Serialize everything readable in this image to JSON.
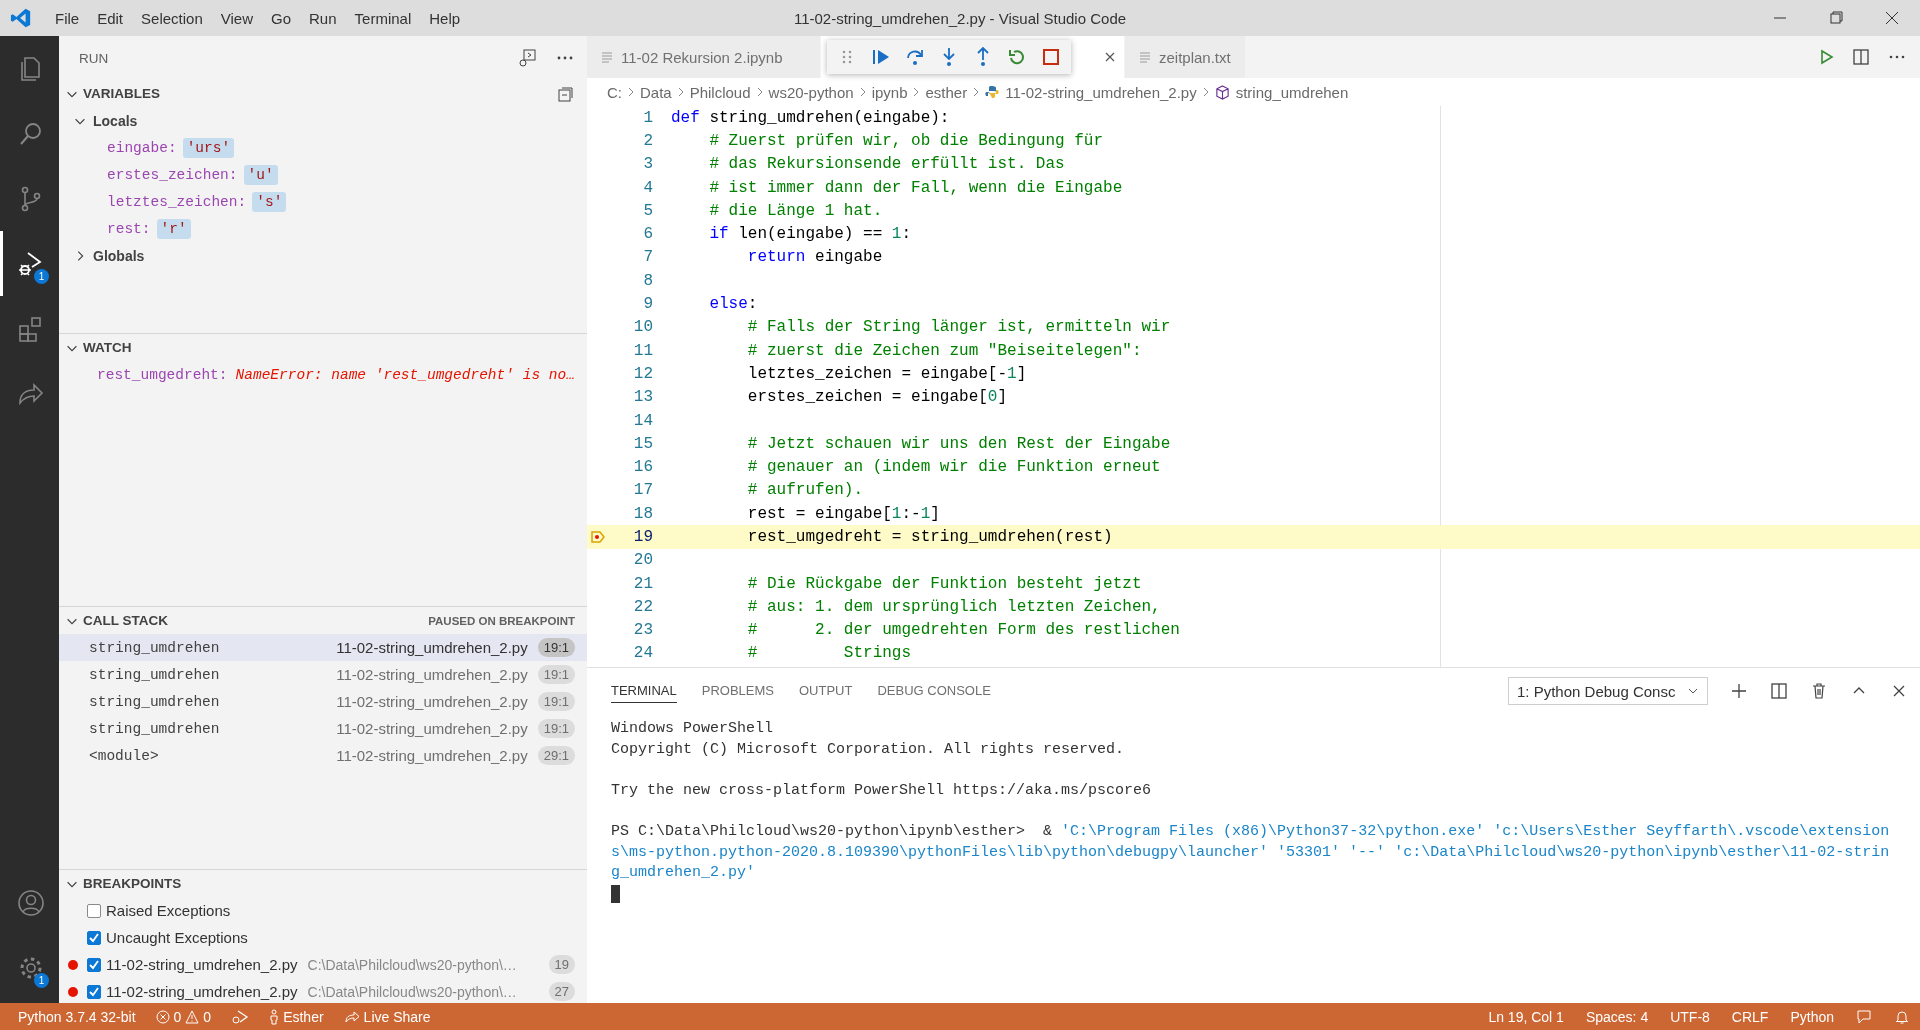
{
  "menu": [
    "File",
    "Edit",
    "Selection",
    "View",
    "Go",
    "Run",
    "Terminal",
    "Help"
  ],
  "window": {
    "title": "11-02-string_umdrehen_2.py - Visual Studio Code"
  },
  "activity_bar": {
    "top": [
      {
        "selected": false
      },
      {
        "selected": false
      },
      {
        "selected": false
      },
      {
        "selected": true,
        "badge": "1"
      },
      {
        "selected": false
      },
      {
        "selected": false
      }
    ],
    "bottom": [
      {
        "selected": false
      },
      {
        "selected": false,
        "badge": "1"
      }
    ]
  },
  "sidebar": {
    "title": "RUN",
    "variables": {
      "title": "VARIABLES",
      "expanded": true,
      "scopes": [
        {
          "label": "Locals",
          "expanded": true,
          "children": [
            {
              "name": "eingabe:",
              "value": "'urs'"
            },
            {
              "name": "erstes_zeichen:",
              "value": "'u'"
            },
            {
              "name": "letztes_zeichen:",
              "value": "'s'"
            },
            {
              "name": "rest:",
              "value": "'r'"
            }
          ]
        },
        {
          "label": "Globals",
          "expanded": false
        }
      ]
    },
    "watch": {
      "title": "WATCH",
      "expanded": true,
      "items": [
        {
          "name": "rest_umgedreht:",
          "value": "NameError: name 'rest_umgedreht' is no…"
        }
      ]
    },
    "call_stack": {
      "title": "CALL STACK",
      "expanded": true,
      "status": "PAUSED ON BREAKPOINT",
      "frames": [
        {
          "function": "string_umdrehen",
          "file": "11-02-string_umdrehen_2.py",
          "position": "19:1",
          "selected": true
        },
        {
          "function": "string_umdrehen",
          "file": "11-02-string_umdrehen_2.py",
          "position": "19:1",
          "selected": false
        },
        {
          "function": "string_umdrehen",
          "file": "11-02-string_umdrehen_2.py",
          "position": "19:1",
          "selected": false
        },
        {
          "function": "string_umdrehen",
          "file": "11-02-string_umdrehen_2.py",
          "position": "19:1",
          "selected": false
        },
        {
          "function": "<module>",
          "file": "11-02-string_umdrehen_2.py",
          "position": "29:1",
          "selected": false
        }
      ]
    },
    "breakpoints": {
      "title": "BREAKPOINTS",
      "expanded": true,
      "items": [
        {
          "kind": "exception",
          "label": "Raised Exceptions",
          "checked": false
        },
        {
          "kind": "exception",
          "label": "Uncaught Exceptions",
          "checked": true
        },
        {
          "kind": "file",
          "label": "11-02-string_umdrehen_2.py",
          "path": "C:\\Data\\Philcloud\\ws20-python\\…",
          "line": "19",
          "checked": true
        },
        {
          "kind": "file",
          "label": "11-02-string_umdrehen_2.py",
          "path": "C:\\Data\\Philcloud\\ws20-python\\…",
          "line": "27",
          "checked": true
        }
      ]
    }
  },
  "editor": {
    "tabs": [
      {
        "kind": "file",
        "label": "11-02 Rekursion 2.ipynb",
        "selected": false
      },
      {
        "kind": "covered",
        "selected": true
      },
      {
        "kind": "file",
        "label": "zeitplan.txt",
        "selected": false
      }
    ],
    "breadcrumb": [
      {
        "kind": "folder",
        "label": "C:"
      },
      {
        "kind": "folder",
        "label": "Data"
      },
      {
        "kind": "folder",
        "label": "Philcloud"
      },
      {
        "kind": "folder",
        "label": "ws20-python"
      },
      {
        "kind": "folder",
        "label": "ipynb"
      },
      {
        "kind": "folder",
        "label": "esther"
      },
      {
        "kind": "file",
        "label": "11-02-string_umdrehen_2.py"
      },
      {
        "kind": "symbol",
        "label": "string_umdrehen"
      }
    ],
    "lines": [
      {
        "number": "1",
        "current": false,
        "segments": [
          {
            "kind": "kw",
            "text": "def"
          },
          {
            "kind": "txt",
            "text": " string_umdrehen(eingabe):"
          }
        ]
      },
      {
        "number": "2",
        "current": false,
        "segments": [
          {
            "kind": "com",
            "text": "    # Zuerst prüfen wir, ob die Bedingung für"
          }
        ]
      },
      {
        "number": "3",
        "current": false,
        "segments": [
          {
            "kind": "com",
            "text": "    # das Rekursionsende erfüllt ist. Das"
          }
        ]
      },
      {
        "number": "4",
        "current": false,
        "segments": [
          {
            "kind": "com",
            "text": "    # ist immer dann der Fall, wenn die Eingabe"
          }
        ]
      },
      {
        "number": "5",
        "current": false,
        "segments": [
          {
            "kind": "com",
            "text": "    # die Länge 1 hat."
          }
        ]
      },
      {
        "number": "6",
        "current": false,
        "segments": [
          {
            "kind": "kw",
            "text": "    if"
          },
          {
            "kind": "txt",
            "text": " len(eingabe) == "
          },
          {
            "kind": "num",
            "text": "1"
          },
          {
            "kind": "txt",
            "text": ":"
          }
        ]
      },
      {
        "number": "7",
        "current": false,
        "segments": [
          {
            "kind": "kw",
            "text": "        return"
          },
          {
            "kind": "txt",
            "text": " eingabe"
          }
        ]
      },
      {
        "number": "8",
        "current": false
      },
      {
        "number": "9",
        "current": false,
        "segments": [
          {
            "kind": "kw",
            "text": "    else"
          },
          {
            "kind": "txt",
            "text": ":"
          }
        ]
      },
      {
        "number": "10",
        "current": false,
        "segments": [
          {
            "kind": "com",
            "text": "        # Falls der String länger ist, ermitteln wir"
          }
        ]
      },
      {
        "number": "11",
        "current": false,
        "segments": [
          {
            "kind": "com",
            "text": "        # zuerst die Zeichen zum \"Beiseitelegen\":"
          }
        ]
      },
      {
        "number": "12",
        "current": false,
        "segments": [
          {
            "kind": "txt",
            "text": "        letztes_zeichen = eingabe[-"
          },
          {
            "kind": "num",
            "text": "1"
          },
          {
            "kind": "txt",
            "text": "]"
          }
        ]
      },
      {
        "number": "13",
        "current": false,
        "segments": [
          {
            "kind": "txt",
            "text": "        erstes_zeichen = eingabe["
          },
          {
            "kind": "num",
            "text": "0"
          },
          {
            "kind": "txt",
            "text": "]"
          }
        ]
      },
      {
        "number": "14",
        "current": false
      },
      {
        "number": "15",
        "current": false,
        "segments": [
          {
            "kind": "com",
            "text": "        # Jetzt schauen wir uns den Rest der Eingabe"
          }
        ]
      },
      {
        "number": "16",
        "current": false,
        "segments": [
          {
            "kind": "com",
            "text": "        # genauer an (indem wir die Funktion erneut"
          }
        ]
      },
      {
        "number": "17",
        "current": false,
        "segments": [
          {
            "kind": "com",
            "text": "        # aufrufen)."
          }
        ]
      },
      {
        "number": "18",
        "current": false,
        "segments": [
          {
            "kind": "txt",
            "text": "        rest = eingabe["
          },
          {
            "kind": "num",
            "text": "1"
          },
          {
            "kind": "txt",
            "text": ":-"
          },
          {
            "kind": "num",
            "text": "1"
          },
          {
            "kind": "txt",
            "text": "]"
          }
        ]
      },
      {
        "number": "19",
        "current": true,
        "segments": [
          {
            "kind": "txt",
            "text": "        rest_umgedreht = string_umdrehen(rest)"
          }
        ]
      },
      {
        "number": "20",
        "current": false
      },
      {
        "number": "21",
        "current": false,
        "segments": [
          {
            "kind": "com",
            "text": "        # Die Rückgabe der Funktion besteht jetzt"
          }
        ]
      },
      {
        "number": "22",
        "current": false,
        "segments": [
          {
            "kind": "com",
            "text": "        # aus: 1. dem ursprünglich letzten Zeichen,"
          }
        ]
      },
      {
        "number": "23",
        "current": false,
        "segments": [
          {
            "kind": "com",
            "text": "        #      2. der umgedrehten Form des restlichen"
          }
        ]
      },
      {
        "number": "24",
        "current": false,
        "segments": [
          {
            "kind": "com",
            "text": "        #         Strings"
          }
        ]
      }
    ]
  },
  "panel": {
    "tabs": [
      {
        "label": "TERMINAL",
        "selected": true
      },
      {
        "label": "PROBLEMS",
        "selected": false
      },
      {
        "label": "OUTPUT",
        "selected": false
      },
      {
        "label": "DEBUG CONSOLE",
        "selected": false
      }
    ],
    "terminal_select": "1: Python Debug Consc",
    "terminal_lines": [
      {
        "segments": [
          {
            "kind": "plain",
            "text": "Windows PowerShell"
          }
        ]
      },
      {
        "segments": [
          {
            "kind": "plain",
            "text": "Copyright (C) Microsoft Corporation. All rights reserved."
          }
        ]
      },
      {
        "spaced_above": true,
        "segments": [
          {
            "kind": "plain",
            "text": "Try the new cross-platform PowerShell https://aka.ms/pscore6"
          }
        ]
      },
      {
        "spaced_above": true,
        "segments": [
          {
            "kind": "plain",
            "text": "PS C:\\Data\\Philcloud\\ws20-python\\ipynb\\esther>  & "
          },
          {
            "kind": "string",
            "text": "'C:\\Program Files (x86)\\Python37-32\\python.exe' 'c:\\Users\\Esther Seyffarth\\.vscode\\extension"
          }
        ]
      },
      {
        "segments": [
          {
            "kind": "string",
            "text": "s\\ms-python.python-2020.8.109390\\pythonFiles\\lib\\python\\debugpy\\launcher' '53301' '--' 'c:\\Data\\Philcloud\\ws20-python\\ipynb\\esther\\11-02-strin"
          }
        ]
      },
      {
        "segments": [
          {
            "kind": "string",
            "text": "g_umdrehen_2.py'"
          }
        ]
      }
    ]
  },
  "status_bar": {
    "python": "Python 3.7.4 32-bit",
    "errors": "0",
    "warnings": "0",
    "user": "Esther",
    "live_share": "Live Share",
    "right": [
      "Ln 19, Col 1",
      "Spaces: 4",
      "UTF-8",
      "CRLF",
      "Python"
    ]
  }
}
